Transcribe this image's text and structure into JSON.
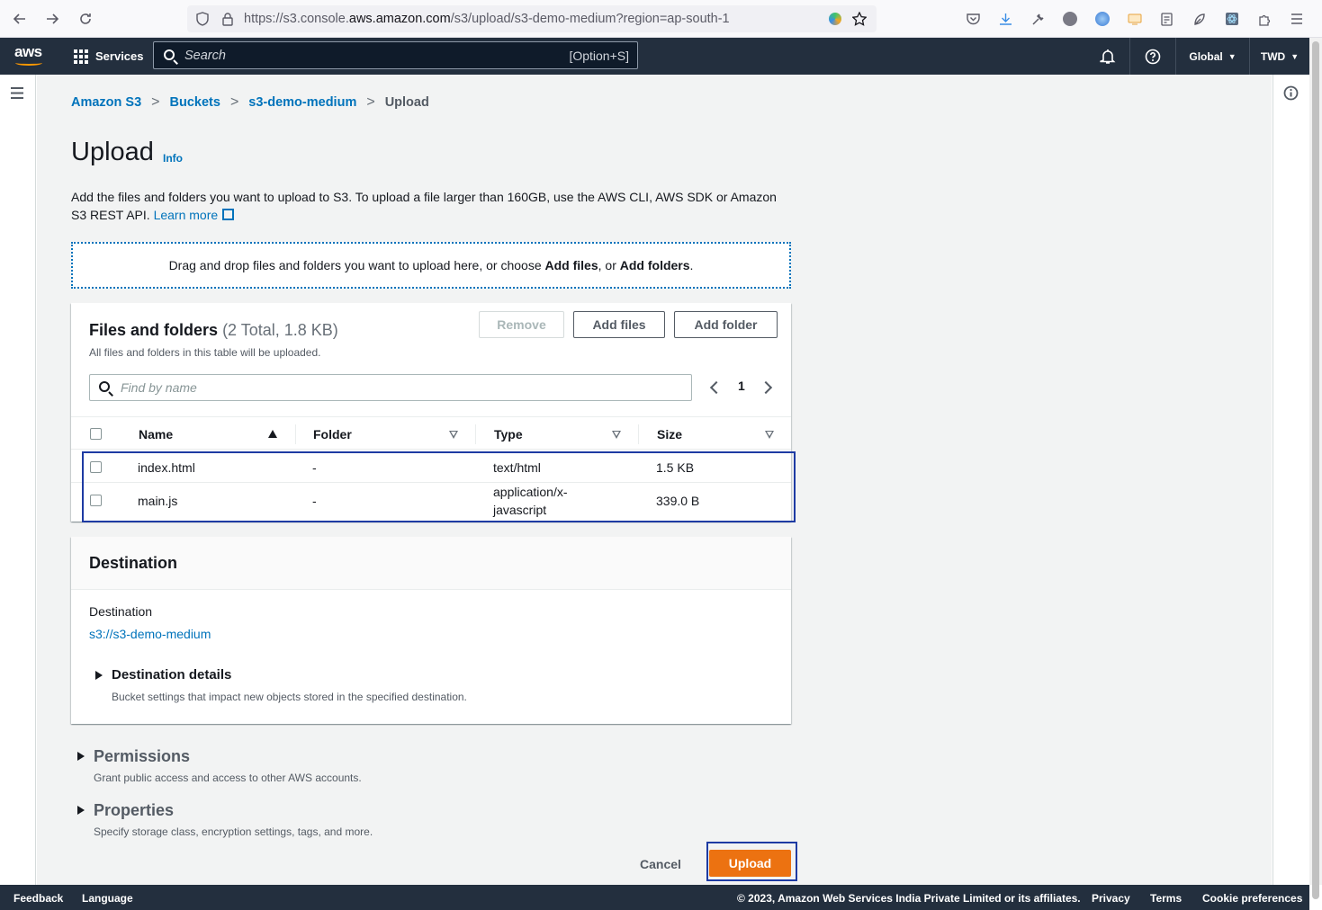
{
  "browser": {
    "url_prefix": "https://s3.console.",
    "url_domain": "aws.amazon.com",
    "url_suffix": "/s3/upload/s3-demo-medium?region=ap-south-1"
  },
  "aws_nav": {
    "logo_text": "aws",
    "services_label": "Services",
    "search_placeholder": "Search",
    "search_shortcut": "[Option+S]",
    "region_label": "Global",
    "account_label": "TWD"
  },
  "breadcrumb": [
    {
      "label": "Amazon S3"
    },
    {
      "label": "Buckets"
    },
    {
      "label": "s3-demo-medium"
    },
    {
      "label": "Upload"
    }
  ],
  "page": {
    "title": "Upload",
    "info_label": "Info",
    "description": "Add the files and folders you want to upload to S3. To upload a file larger than 160GB, use the AWS CLI, AWS SDK or Amazon S3 REST API.",
    "learn_more_label": "Learn more",
    "drop_zone_text_1": "Drag and drop files and folders you want to upload here, or choose ",
    "drop_zone_add_files": "Add files",
    "drop_zone_text_2": ", or ",
    "drop_zone_add_folders": "Add folders",
    "drop_zone_text_3": "."
  },
  "files_panel": {
    "title": "Files and folders",
    "count": "(2 Total, 1.8 KB)",
    "subtitle": "All files and folders in this table will be uploaded.",
    "remove_label": "Remove",
    "add_files_label": "Add files",
    "add_folder_label": "Add folder",
    "find_placeholder": "Find by name",
    "page_number": "1",
    "columns": [
      "Name",
      "Folder",
      "Type",
      "Size"
    ],
    "rows": [
      {
        "name": "index.html",
        "folder": "-",
        "type": "text/html",
        "size": "1.5 KB"
      },
      {
        "name": "main.js",
        "folder": "-",
        "type_line1": "application/x-",
        "type_line2": "javascript",
        "size": "339.0 B"
      }
    ]
  },
  "destination_panel": {
    "title": "Destination",
    "label": "Destination",
    "value": "s3://s3-demo-medium",
    "details_title": "Destination details",
    "details_sub": "Bucket settings that impact new objects stored in the specified destination."
  },
  "permissions": {
    "title": "Permissions",
    "sub": "Grant public access and access to other AWS accounts."
  },
  "properties": {
    "title": "Properties",
    "sub": "Specify storage class, encryption settings, tags, and more."
  },
  "actions": {
    "cancel_label": "Cancel",
    "upload_label": "Upload"
  },
  "footer": {
    "feedback": "Feedback",
    "language": "Language",
    "copyright": "© 2023, Amazon Web Services India Private Limited or its affiliates.",
    "privacy": "Privacy",
    "terms": "Terms",
    "cookie": "Cookie preferences"
  },
  "colors": {
    "aws_nav_bg": "#232f3e",
    "link": "#0073bb",
    "primary_button": "#ec7211",
    "highlight": "#1e3ba3"
  }
}
